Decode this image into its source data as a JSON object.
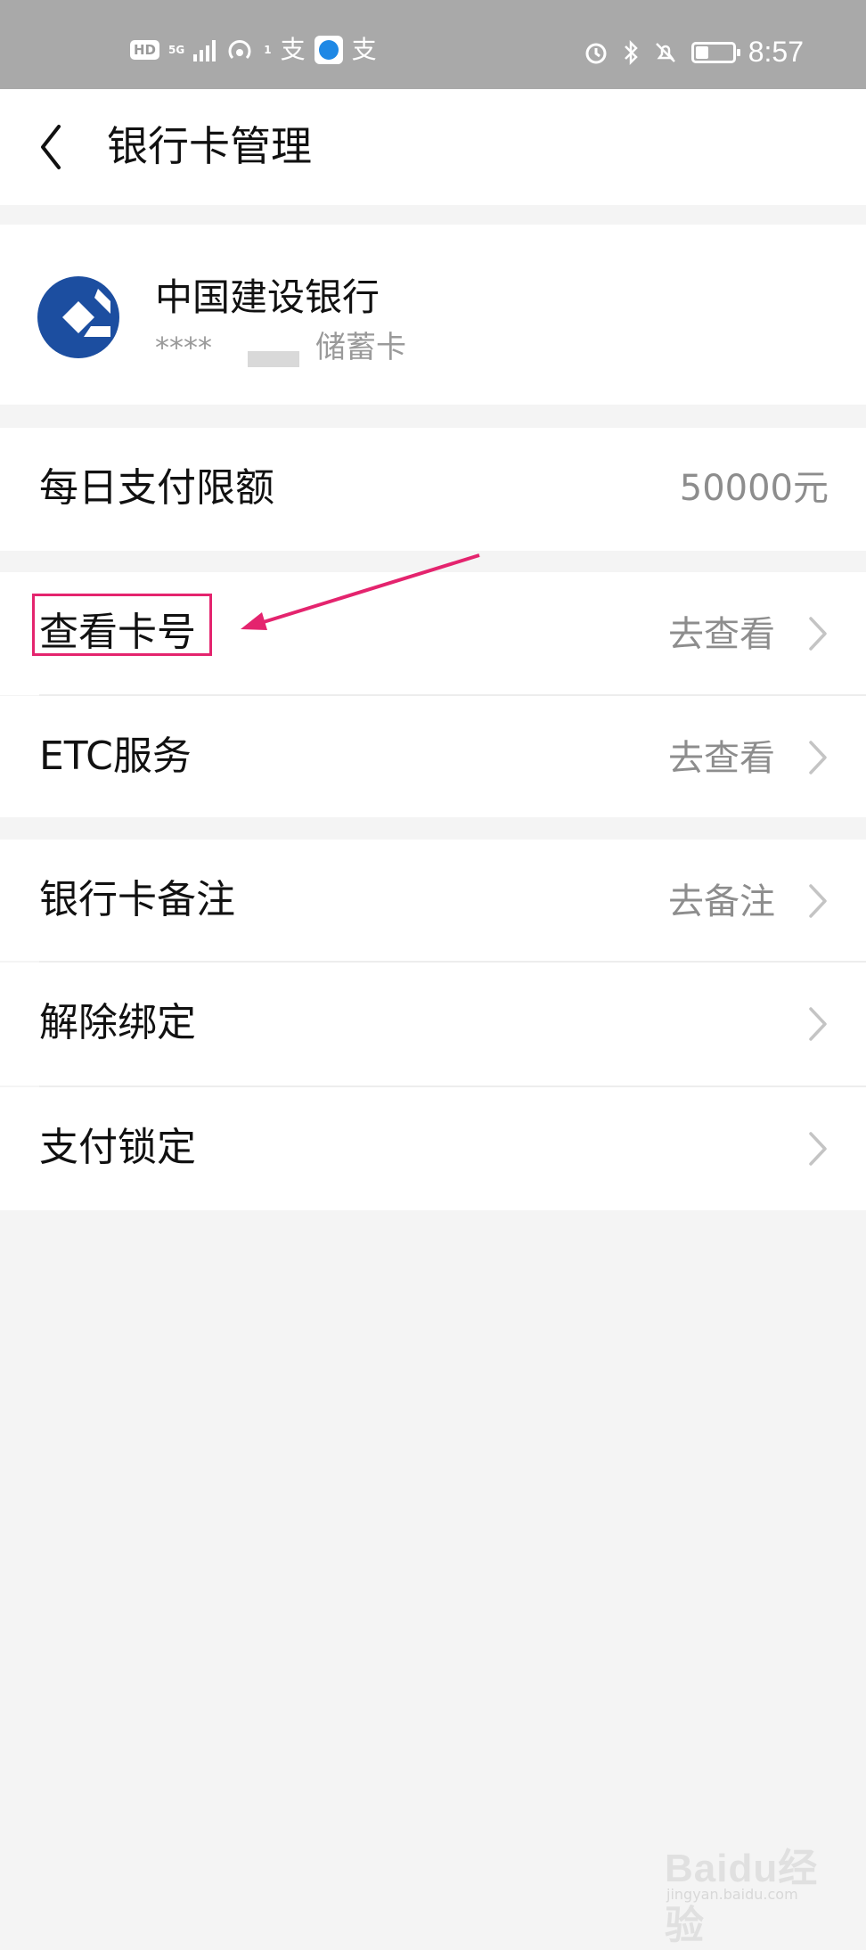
{
  "status_bar": {
    "hd": "HD",
    "network": "5G",
    "signal_sub": "1",
    "alipay_glyph_1": "支",
    "alipay_glyph_2": "支",
    "time": "8:57"
  },
  "header": {
    "title": "银行卡管理"
  },
  "card": {
    "bank_name": "中国建设银行",
    "masked_number": "****",
    "card_type": "储蓄卡"
  },
  "daily_limit": {
    "label": "每日支付限额",
    "value": "50000元"
  },
  "section1": {
    "items": [
      {
        "label": "查看卡号",
        "action": "去查看"
      },
      {
        "label": "ETC服务",
        "action": "去查看"
      }
    ]
  },
  "section2": {
    "items": [
      {
        "label": "银行卡备注",
        "action": "去备注"
      },
      {
        "label": "解除绑定",
        "action": ""
      },
      {
        "label": "支付锁定",
        "action": ""
      }
    ]
  },
  "watermark": {
    "main": "Baidu经验",
    "sub": "jingyan.baidu.com"
  },
  "colors": {
    "status_bar_bg": "#a9a9a9",
    "highlight": "#e4246e",
    "ccb_blue": "#1c4ea0"
  }
}
